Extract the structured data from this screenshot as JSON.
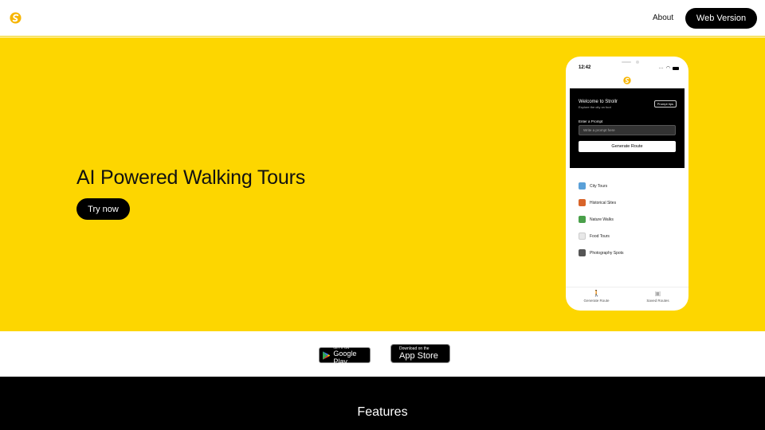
{
  "nav": {
    "about_label": "About",
    "web_version_label": "Web Version"
  },
  "hero": {
    "title": "AI Powered Walking Tours",
    "cta_label": "Try now"
  },
  "phone": {
    "time": "12:42",
    "card": {
      "welcome": "Welcome to Strollr",
      "subtitle": "Explore the city on foot",
      "tips_label": "Prompt tips",
      "prompt_label": "Enter a Prompt",
      "prompt_placeholder": "Write a prompt here",
      "generate_label": "Generate Route"
    },
    "categories": [
      {
        "label": "City Tours",
        "icon": "cityscape-icon",
        "color": "#5aa0d8"
      },
      {
        "label": "Historical Sites",
        "icon": "castle-icon",
        "color": "#d8642a"
      },
      {
        "label": "Nature Walks",
        "icon": "landscape-icon",
        "color": "#4aa04a"
      },
      {
        "label": "Food Tours",
        "icon": "menu-icon",
        "color": "#e8e8e8"
      },
      {
        "label": "Photography Spots",
        "icon": "camera-icon",
        "color": "#555555"
      }
    ],
    "tabs": [
      {
        "label": "Generate Route",
        "icon": "walker-icon"
      },
      {
        "label": "Saved Routes",
        "icon": "save-icon"
      }
    ]
  },
  "stores": {
    "google_small": "GET IT ON",
    "google_big": "Google Play",
    "apple_small": "Download on the",
    "apple_big": "App Store"
  },
  "features": {
    "title": "Features"
  },
  "colors": {
    "brand_yellow": "#fdd600",
    "dark": "#000000"
  }
}
